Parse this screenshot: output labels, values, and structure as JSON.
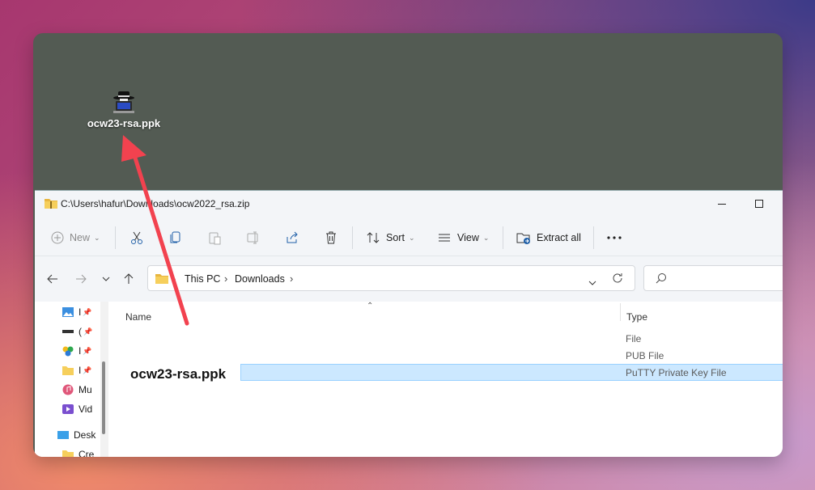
{
  "desktop": {
    "icon_label": "ocw23-rsa.ppk"
  },
  "explorer": {
    "title": "C:\\Users\\hafur\\Downloads\\ocw2022_rsa.zip",
    "toolbar": {
      "new_label": "New",
      "sort_label": "Sort",
      "view_label": "View",
      "extract_label": "Extract all"
    },
    "breadcrumb": [
      "This PC",
      "Downloads"
    ],
    "nav_items": [
      {
        "icon": "pictures-icon",
        "label": "I"
      },
      {
        "icon": "drive-icon",
        "label": "("
      },
      {
        "icon": "images-icon",
        "label": "I"
      },
      {
        "icon": "folder-icon",
        "label": "I"
      },
      {
        "icon": "music-icon",
        "label": "Mu"
      },
      {
        "icon": "video-icon",
        "label": "Vid"
      },
      {
        "icon": "desktop-icon",
        "label": "Desk"
      },
      {
        "icon": "folder-icon",
        "label": "Cre"
      }
    ],
    "columns": {
      "name": "Name",
      "type": "Type"
    },
    "rows": [
      {
        "type": "File"
      },
      {
        "type": "PUB File"
      },
      {
        "type": "PuTTY Private Key File"
      }
    ],
    "overlay_filename": "ocw23-rsa.ppk"
  },
  "colors": {
    "arrow": "#f2424f",
    "selection": "#cce8ff",
    "desktop_bg": "#535b53"
  }
}
